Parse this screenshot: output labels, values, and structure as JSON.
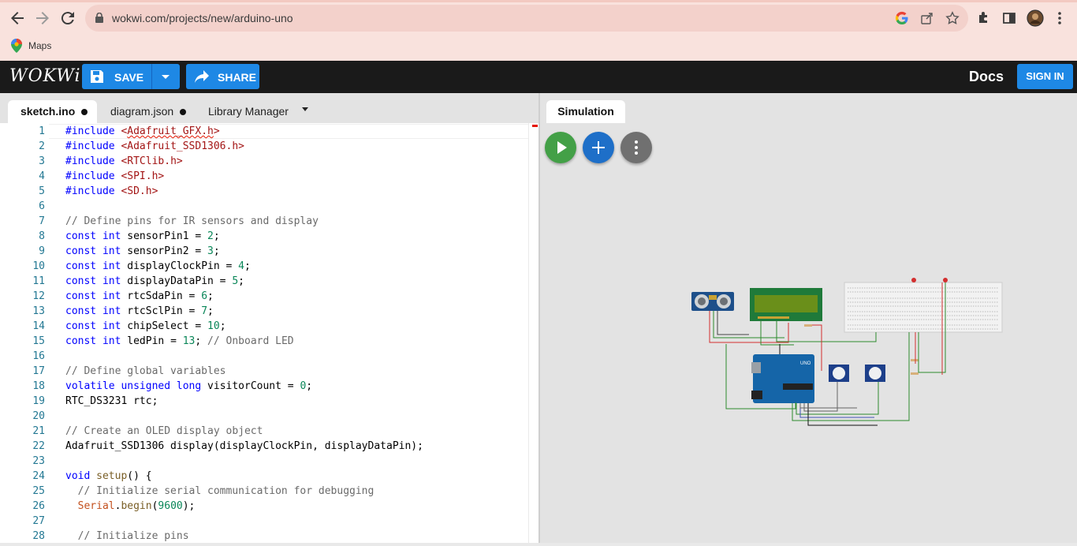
{
  "browser": {
    "url": "wokwi.com/projects/new/arduino-uno",
    "bookmarks": [
      {
        "label": "Maps",
        "icon": "maps-pin-icon"
      }
    ],
    "nav_icons": [
      "back-arrow-icon",
      "forward-arrow-icon",
      "reload-icon"
    ],
    "omnibox_icons": [
      "google-icon",
      "share-page-icon",
      "bookmark-star-icon"
    ],
    "toolbar_icons": [
      "extensions-puzzle-icon",
      "side-panel-icon",
      "profile-avatar-icon",
      "more-vert-icon"
    ]
  },
  "app": {
    "logo": "WOKWi",
    "save_label": "SAVE",
    "share_label": "SHARE",
    "docs_label": "Docs",
    "signin_label": "SIGN IN"
  },
  "editor": {
    "tabs": [
      {
        "label": "sketch.ino",
        "modified": true,
        "active": true
      },
      {
        "label": "diagram.json",
        "modified": true,
        "active": false
      },
      {
        "label": "Library Manager",
        "modified": false,
        "active": false
      }
    ],
    "lines": [
      {
        "n": "1",
        "text": "#include <Adafruit_GFX.h>"
      },
      {
        "n": "2",
        "text": "#include <Adafruit_SSD1306.h>"
      },
      {
        "n": "3",
        "text": "#include <RTClib.h>"
      },
      {
        "n": "4",
        "text": "#include <SPI.h>"
      },
      {
        "n": "5",
        "text": "#include <SD.h>"
      },
      {
        "n": "6",
        "text": ""
      },
      {
        "n": "7",
        "text": "// Define pins for IR sensors and display"
      },
      {
        "n": "8",
        "text": "const int sensorPin1 = 2;"
      },
      {
        "n": "9",
        "text": "const int sensorPin2 = 3;"
      },
      {
        "n": "10",
        "text": "const int displayClockPin = 4;"
      },
      {
        "n": "11",
        "text": "const int displayDataPin = 5;"
      },
      {
        "n": "12",
        "text": "const int rtcSdaPin = 6;"
      },
      {
        "n": "13",
        "text": "const int rtcSclPin = 7;"
      },
      {
        "n": "14",
        "text": "const int chipSelect = 10;"
      },
      {
        "n": "15",
        "text": "const int ledPin = 13; // Onboard LED"
      },
      {
        "n": "16",
        "text": ""
      },
      {
        "n": "17",
        "text": "// Define global variables"
      },
      {
        "n": "18",
        "text": "volatile unsigned long visitorCount = 0;"
      },
      {
        "n": "19",
        "text": "RTC_DS3231 rtc;"
      },
      {
        "n": "20",
        "text": ""
      },
      {
        "n": "21",
        "text": "// Create an OLED display object"
      },
      {
        "n": "22",
        "text": "Adafruit_SSD1306 display(displayClockPin, displayDataPin);"
      },
      {
        "n": "23",
        "text": ""
      },
      {
        "n": "24",
        "text": "void setup() {"
      },
      {
        "n": "25",
        "text": "  // Initialize serial communication for debugging"
      },
      {
        "n": "26",
        "text": "  Serial.begin(9600);"
      },
      {
        "n": "27",
        "text": ""
      },
      {
        "n": "28",
        "text": "  // Initialize pins"
      }
    ]
  },
  "simulation": {
    "tab_label": "Simulation",
    "buttons": [
      {
        "name": "start-simulation-button",
        "icon": "play-icon",
        "color": "#43a047"
      },
      {
        "name": "add-part-button",
        "icon": "plus-icon",
        "color": "#1e6fc8"
      },
      {
        "name": "more-options-button",
        "icon": "more-vert-icon",
        "color": "#707070"
      }
    ],
    "board_label": "UNO",
    "colors": {
      "wire_green": "#2e8b2e",
      "wire_red": "#d32f2f",
      "board_blue": "#1565a8",
      "lcd_green": "#6a8f1a"
    }
  },
  "colors": {
    "accent": "#1e88e5",
    "header_bg": "#1a1a1a",
    "chrome_bg": "#f9e2dd"
  }
}
